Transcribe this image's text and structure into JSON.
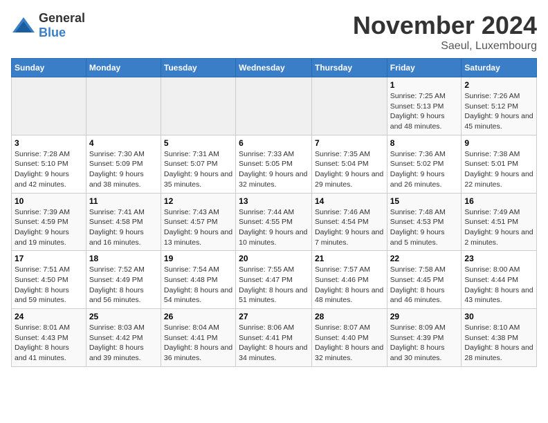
{
  "header": {
    "logo_general": "General",
    "logo_blue": "Blue",
    "month_title": "November 2024",
    "location": "Saeul, Luxembourg"
  },
  "days_of_week": [
    "Sunday",
    "Monday",
    "Tuesday",
    "Wednesday",
    "Thursday",
    "Friday",
    "Saturday"
  ],
  "weeks": [
    [
      {
        "day": "",
        "info": ""
      },
      {
        "day": "",
        "info": ""
      },
      {
        "day": "",
        "info": ""
      },
      {
        "day": "",
        "info": ""
      },
      {
        "day": "",
        "info": ""
      },
      {
        "day": "1",
        "info": "Sunrise: 7:25 AM\nSunset: 5:13 PM\nDaylight: 9 hours and 48 minutes."
      },
      {
        "day": "2",
        "info": "Sunrise: 7:26 AM\nSunset: 5:12 PM\nDaylight: 9 hours and 45 minutes."
      }
    ],
    [
      {
        "day": "3",
        "info": "Sunrise: 7:28 AM\nSunset: 5:10 PM\nDaylight: 9 hours and 42 minutes."
      },
      {
        "day": "4",
        "info": "Sunrise: 7:30 AM\nSunset: 5:09 PM\nDaylight: 9 hours and 38 minutes."
      },
      {
        "day": "5",
        "info": "Sunrise: 7:31 AM\nSunset: 5:07 PM\nDaylight: 9 hours and 35 minutes."
      },
      {
        "day": "6",
        "info": "Sunrise: 7:33 AM\nSunset: 5:05 PM\nDaylight: 9 hours and 32 minutes."
      },
      {
        "day": "7",
        "info": "Sunrise: 7:35 AM\nSunset: 5:04 PM\nDaylight: 9 hours and 29 minutes."
      },
      {
        "day": "8",
        "info": "Sunrise: 7:36 AM\nSunset: 5:02 PM\nDaylight: 9 hours and 26 minutes."
      },
      {
        "day": "9",
        "info": "Sunrise: 7:38 AM\nSunset: 5:01 PM\nDaylight: 9 hours and 22 minutes."
      }
    ],
    [
      {
        "day": "10",
        "info": "Sunrise: 7:39 AM\nSunset: 4:59 PM\nDaylight: 9 hours and 19 minutes."
      },
      {
        "day": "11",
        "info": "Sunrise: 7:41 AM\nSunset: 4:58 PM\nDaylight: 9 hours and 16 minutes."
      },
      {
        "day": "12",
        "info": "Sunrise: 7:43 AM\nSunset: 4:57 PM\nDaylight: 9 hours and 13 minutes."
      },
      {
        "day": "13",
        "info": "Sunrise: 7:44 AM\nSunset: 4:55 PM\nDaylight: 9 hours and 10 minutes."
      },
      {
        "day": "14",
        "info": "Sunrise: 7:46 AM\nSunset: 4:54 PM\nDaylight: 9 hours and 7 minutes."
      },
      {
        "day": "15",
        "info": "Sunrise: 7:48 AM\nSunset: 4:53 PM\nDaylight: 9 hours and 5 minutes."
      },
      {
        "day": "16",
        "info": "Sunrise: 7:49 AM\nSunset: 4:51 PM\nDaylight: 9 hours and 2 minutes."
      }
    ],
    [
      {
        "day": "17",
        "info": "Sunrise: 7:51 AM\nSunset: 4:50 PM\nDaylight: 8 hours and 59 minutes."
      },
      {
        "day": "18",
        "info": "Sunrise: 7:52 AM\nSunset: 4:49 PM\nDaylight: 8 hours and 56 minutes."
      },
      {
        "day": "19",
        "info": "Sunrise: 7:54 AM\nSunset: 4:48 PM\nDaylight: 8 hours and 54 minutes."
      },
      {
        "day": "20",
        "info": "Sunrise: 7:55 AM\nSunset: 4:47 PM\nDaylight: 8 hours and 51 minutes."
      },
      {
        "day": "21",
        "info": "Sunrise: 7:57 AM\nSunset: 4:46 PM\nDaylight: 8 hours and 48 minutes."
      },
      {
        "day": "22",
        "info": "Sunrise: 7:58 AM\nSunset: 4:45 PM\nDaylight: 8 hours and 46 minutes."
      },
      {
        "day": "23",
        "info": "Sunrise: 8:00 AM\nSunset: 4:44 PM\nDaylight: 8 hours and 43 minutes."
      }
    ],
    [
      {
        "day": "24",
        "info": "Sunrise: 8:01 AM\nSunset: 4:43 PM\nDaylight: 8 hours and 41 minutes."
      },
      {
        "day": "25",
        "info": "Sunrise: 8:03 AM\nSunset: 4:42 PM\nDaylight: 8 hours and 39 minutes."
      },
      {
        "day": "26",
        "info": "Sunrise: 8:04 AM\nSunset: 4:41 PM\nDaylight: 8 hours and 36 minutes."
      },
      {
        "day": "27",
        "info": "Sunrise: 8:06 AM\nSunset: 4:41 PM\nDaylight: 8 hours and 34 minutes."
      },
      {
        "day": "28",
        "info": "Sunrise: 8:07 AM\nSunset: 4:40 PM\nDaylight: 8 hours and 32 minutes."
      },
      {
        "day": "29",
        "info": "Sunrise: 8:09 AM\nSunset: 4:39 PM\nDaylight: 8 hours and 30 minutes."
      },
      {
        "day": "30",
        "info": "Sunrise: 8:10 AM\nSunset: 4:38 PM\nDaylight: 8 hours and 28 minutes."
      }
    ]
  ]
}
